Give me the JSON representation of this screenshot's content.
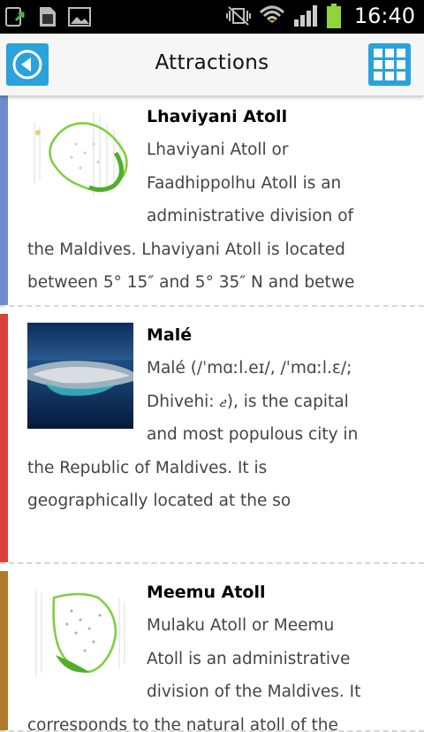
{
  "status_bar": {
    "time": "16:40",
    "icons": [
      "sync-icon",
      "sd-card-icon",
      "image-icon",
      "vibrate-icon",
      "wifi-icon",
      "signal-icon",
      "battery-icon"
    ]
  },
  "header": {
    "title": "Attractions",
    "back_icon": "back-arrow-icon",
    "grid_icon": "grid-icon",
    "accent_color": "#2aa2db"
  },
  "attractions": [
    {
      "title": "Lhaviyani Atoll",
      "description": "Lhaviyani Atoll or Faadhippolhu Atoll is an administrative division of the Maldives. Lhaviyani Atoll is located between 5° 15″ and 5° 35″ N and betwe",
      "accent_color": "#6c8ccc",
      "thumbnail": "atoll-map"
    },
    {
      "title": "Malé",
      "description": "Malé (/ˈmɑːl.eɪ/, /ˈmɑːl.ɛ/; Dhivehi: ޖ), is the capital and most populous city in the Republic of Maldives. It is geographically located at the so",
      "accent_color": "#d9413b",
      "thumbnail": "aerial-city-photo"
    },
    {
      "title": "Meemu Atoll",
      "description": "Mulaku Atoll or Meemu Atoll is an administrative division of the Maldives. It corresponds to the natural atoll of the",
      "accent_color": "#b07a2a",
      "thumbnail": "atoll-map"
    }
  ]
}
